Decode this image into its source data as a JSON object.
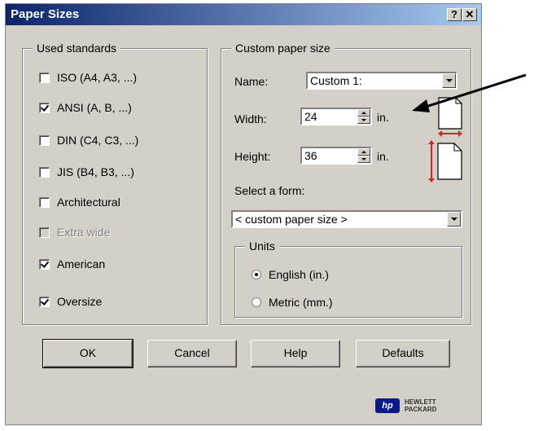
{
  "window": {
    "title": "Paper Sizes",
    "help_btn": "?",
    "close_btn": "✕"
  },
  "standards": {
    "label": "Used standards",
    "items": [
      {
        "label": "ISO (A4, A3, ...)",
        "checked": false
      },
      {
        "label": "ANSI (A, B, ...)",
        "checked": true
      },
      {
        "label": "DIN (C4, C3, ...)",
        "checked": false
      },
      {
        "label": "JIS (B4, B3, ...)",
        "checked": false
      },
      {
        "label": "Architectural",
        "checked": false
      },
      {
        "label": "Extra wide",
        "checked": false,
        "disabled": true
      },
      {
        "label": "American",
        "checked": true
      },
      {
        "label": "Oversize",
        "checked": true
      }
    ]
  },
  "custom": {
    "label": "Custom paper size",
    "name_label": "Name:",
    "name_value": "Custom 1:",
    "width_label": "Width:",
    "width_value": "24",
    "width_unit": "in.",
    "height_label": "Height:",
    "height_value": "36",
    "height_unit": "in.",
    "form_label": "Select a form:",
    "form_value": "< custom paper size >"
  },
  "units": {
    "label": "Units",
    "options": [
      {
        "label": "English (in.)",
        "selected": true
      },
      {
        "label": "Metric (mm.)",
        "selected": false
      }
    ]
  },
  "buttons": {
    "ok": "OK",
    "cancel": "Cancel",
    "help": "Help",
    "defaults": "Defaults"
  },
  "brand": {
    "logo": "hp",
    "line1": "HEWLETT",
    "line2": "PACKARD"
  },
  "colors": {
    "accent_red": "#e02020",
    "title_blue": "#0a246a"
  }
}
